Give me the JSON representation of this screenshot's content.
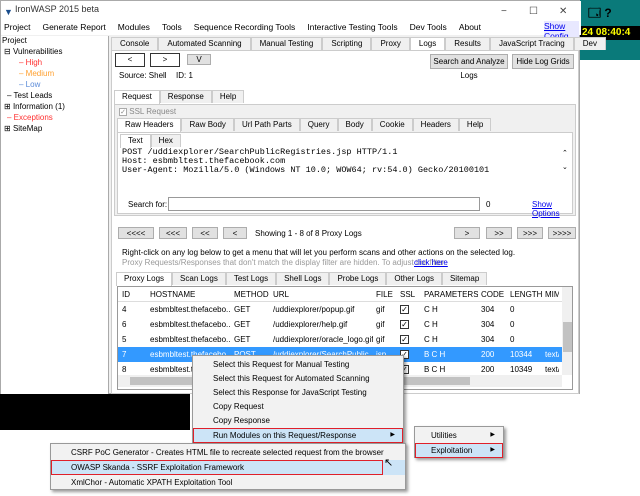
{
  "window": {
    "title": "IronWASP 2015 beta",
    "min": "−",
    "max": "☐",
    "close": "✕"
  },
  "desktop": {
    "clock": "24 08:40:4",
    "icons": "🗔 ?"
  },
  "menu": [
    "Project",
    "Generate Report",
    "Modules",
    "Tools",
    "Sequence Recording Tools",
    "Interactive Testing Tools",
    "Dev Tools",
    "About"
  ],
  "show_config": "Show Config",
  "tree": {
    "root": "Project",
    "vulns": "Vulnerabilities",
    "high": "High",
    "medium": "Medium",
    "low": "Low",
    "test_leads": "Test Leads",
    "information": "Information (1)",
    "exceptions": "Exceptions",
    "sitemap": "SiteMap"
  },
  "colors": {
    "high": "#ff3030",
    "medium": "#ffa030",
    "low": "#5a8ad8",
    "exceptions": "#ff3030",
    "selected": "#3399ff",
    "highlight": "#cce4f7",
    "outline": "#e0202a"
  },
  "main_tabs": [
    "Console",
    "Automated Scanning",
    "Manual Testing",
    "Scripting",
    "Proxy",
    "Logs",
    "Results",
    "JavaScript Tracing",
    "Dev"
  ],
  "nav": {
    "prev": "<",
    "next": ">",
    "down": "V",
    "search_logs": "Search and Analyze Logs",
    "hide_grids": "Hide Log Grids",
    "source": "Source: Shell",
    "id": "ID: 1"
  },
  "req_tabs": [
    "Request",
    "Response",
    "Help"
  ],
  "ssl_request": "SSL Request",
  "raw_tabs": [
    "Raw Headers",
    "Raw Body",
    "Url Path Parts",
    "Query",
    "Body",
    "Cookie",
    "Headers",
    "Help"
  ],
  "text_tabs": [
    "Text",
    "Hex"
  ],
  "request_text": "POST /uddiexplorer/SearchPublicRegistries.jsp HTTP/1.1\nHost: esbmbltest.thefacebook.com\nUser-Agent: Mozilla/5.0 (Windows NT 10.0; WOW64; rv:54.0) Gecko/20100101",
  "search": {
    "label": "Search for:",
    "value": "",
    "count": "0",
    "show_options": "Show Options"
  },
  "pager": {
    "first": "<<<<",
    "prev3": "<<<",
    "prev2": "<<",
    "prev": "<",
    "status": "Showing 1 - 8 of 8 Proxy Logs",
    "next": ">",
    "next2": ">>",
    "next3": ">>>",
    "last": ">>>>"
  },
  "info1": "Right-click on any log below to get a menu that will let you perform scans and other actions on the selected log.",
  "info2": "Proxy Requests/Responses that don't match the display filter are hidden. To adjust the filter",
  "click_here": "click here",
  "log_tabs": [
    "Proxy Logs",
    "Scan Logs",
    "Test Logs",
    "Shell Logs",
    "Probe Logs",
    "Other Logs",
    "Sitemap"
  ],
  "columns": [
    "ID",
    "HOSTNAME",
    "METHOD",
    "URL",
    "FILE",
    "SSL",
    "PARAMETERS",
    "CODE",
    "LENGTH",
    "MIME"
  ],
  "rows": [
    [
      "4",
      "esbmbltest.thefacebo...",
      "GET",
      "/uddiexplorer/popup.gif",
      "gif",
      "✓",
      "C H",
      "304",
      "0",
      ""
    ],
    [
      "6",
      "esbmbltest.thefacebo...",
      "GET",
      "/uddiexplorer/help.gif",
      "gif",
      "✓",
      "C H",
      "304",
      "0",
      ""
    ],
    [
      "5",
      "esbmbltest.thefacebo...",
      "GET",
      "/uddiexplorer/oracle_logo.gif",
      "gif",
      "✓",
      "C H",
      "304",
      "0",
      ""
    ],
    [
      "7",
      "esbmbltest.thefacebo...",
      "POST",
      "/uddiexplorer/SearchPublic...",
      "jsp",
      "✓",
      "B C H",
      "200",
      "10344",
      "text/html"
    ],
    [
      "8",
      "esbmbltest.th",
      "",
      "",
      "",
      "✓",
      "B C H",
      "200",
      "10349",
      "text/html"
    ]
  ],
  "context_menu": [
    "Select this Request for Manual Testing",
    "Select this Request for Automated Scanning",
    "Select this Response for JavaScript Testing",
    "Copy Request",
    "Copy Response",
    "Run Modules on this Request/Response"
  ],
  "modules_menu": [
    "Utilities",
    "Exploitation"
  ],
  "exploitation_menu": [
    "CSRF PoC Generator - Creates HTML file to recreate selected request from the browser",
    "OWASP Skanda - SSRF Exploitation Framework",
    "XmlChor - Automatic XPATH Exploitation Tool"
  ]
}
